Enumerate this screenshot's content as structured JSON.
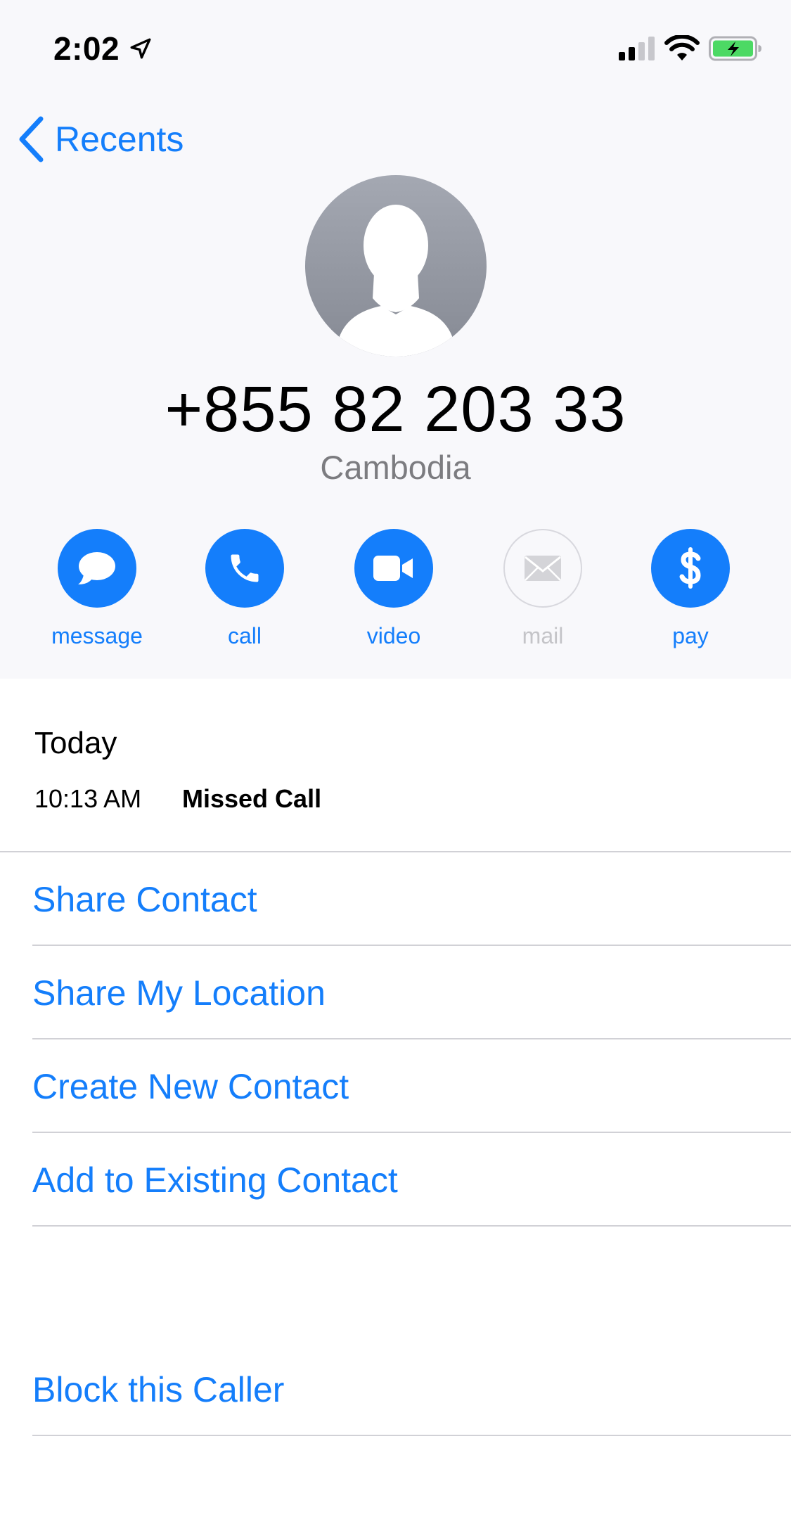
{
  "status_bar": {
    "time": "2:02"
  },
  "nav": {
    "back_label": "Recents"
  },
  "contact": {
    "number": "+855 82 203 33",
    "location": "Cambodia"
  },
  "actions": [
    {
      "label": "message",
      "icon": "message-bubble-icon",
      "enabled": true
    },
    {
      "label": "call",
      "icon": "phone-icon",
      "enabled": true
    },
    {
      "label": "video",
      "icon": "video-camera-icon",
      "enabled": true
    },
    {
      "label": "mail",
      "icon": "mail-icon",
      "enabled": false
    },
    {
      "label": "pay",
      "icon": "dollar-icon",
      "enabled": true
    }
  ],
  "history": {
    "date_header": "Today",
    "entries": [
      {
        "time": "10:13 AM",
        "type": "Missed Call"
      }
    ]
  },
  "menu": {
    "share_contact": "Share Contact",
    "share_location": "Share My Location",
    "create_contact": "Create New Contact",
    "add_existing": "Add to Existing Contact",
    "block_caller": "Block this Caller"
  },
  "colors": {
    "accent": "#147efb",
    "disabled": "#c4c4c8",
    "secondary_text": "#7c7c80",
    "battery_green": "#4cd964"
  }
}
